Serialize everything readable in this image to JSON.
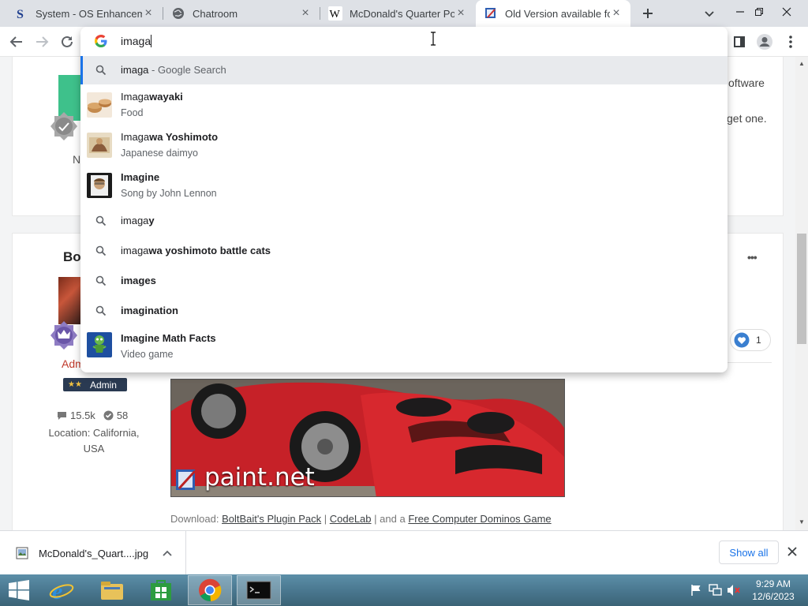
{
  "tabs": [
    {
      "title": "System - OS Enhancements",
      "active": false
    },
    {
      "title": "Chatroom",
      "active": false
    },
    {
      "title": "McDonald's Quarter Pounder",
      "active": false
    },
    {
      "title": "Old Version available for",
      "active": true
    }
  ],
  "omnibox": {
    "typed": "imaga"
  },
  "suggestions": [
    {
      "type": "search",
      "plain": "imaga",
      "bold": "",
      "extra": " - Google Search"
    },
    {
      "type": "entity",
      "plain": "Imaga",
      "bold": "wayaki",
      "sub": "Food"
    },
    {
      "type": "entity",
      "plain": "Imaga",
      "bold": "wa Yoshimoto",
      "sub": "Japanese daimyo"
    },
    {
      "type": "entity",
      "plain": "",
      "bold": "Imagine",
      "sub": "Song by John Lennon"
    },
    {
      "type": "search",
      "plain": "imaga",
      "bold": "y"
    },
    {
      "type": "search",
      "plain": "imaga",
      "bold": "wa yoshimoto battle cats"
    },
    {
      "type": "search",
      "plain": "",
      "bold": "images"
    },
    {
      "type": "search",
      "plain": "",
      "bold": "imagination"
    },
    {
      "type": "entity",
      "plain": "",
      "bold": "Imagine Math Facts",
      "sub": "Video game"
    }
  ],
  "page": {
    "card1_right_text_1": "oftware",
    "card1_right_text_2": "get one.",
    "card1_left_label": "N",
    "author_name_partial": "Bo",
    "author_role_partial": "Adm",
    "admin_badge": "Admin",
    "admin_stars": "★★",
    "posts_count": "15.5k",
    "reputation": "58",
    "location": "Location: California, USA",
    "like_count": "1",
    "more_menu": "•••",
    "signature_logo_text": "paint.net",
    "download_prefix": "Download:",
    "link_pluginpack": "BoltBait's Plugin Pack",
    "sep1": "|",
    "link_codelab": "CodeLab",
    "and_a": "| and a",
    "link_dominos": "Free Computer Dominos Game"
  },
  "download_bar": {
    "filename": "McDonald's_Quart....jpg",
    "show_all": "Show all"
  },
  "taskbar": {
    "time": "9:29 AM",
    "date": "12/6/2023"
  },
  "colors": {
    "accent": "#1a73e8",
    "admin_badge_bg": "#2a3a52"
  }
}
